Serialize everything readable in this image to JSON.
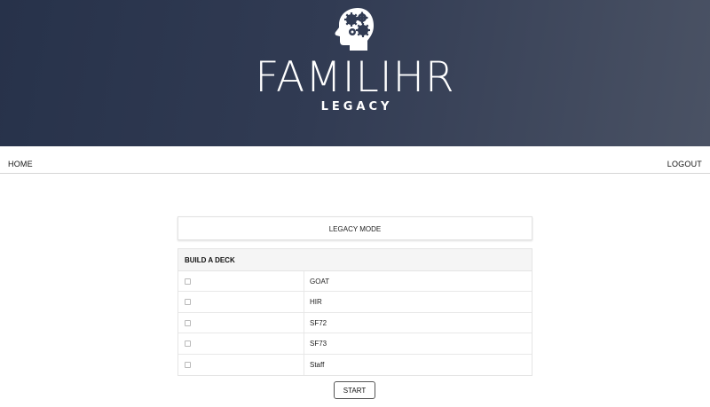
{
  "brand": {
    "title": "FAMILIHR",
    "subtitle": "LEGACY",
    "logo_icon": "brain-gears-icon"
  },
  "nav": {
    "home": "HOME",
    "logout": "LOGOUT"
  },
  "mode": {
    "label": "LEGACY MODE"
  },
  "deck": {
    "heading": "BUILD A DECK",
    "options": [
      {
        "label": "GOAT",
        "checked": false
      },
      {
        "label": "HIR",
        "checked": false
      },
      {
        "label": "SF72",
        "checked": false
      },
      {
        "label": "SF73",
        "checked": false
      },
      {
        "label": "Staff",
        "checked": false
      }
    ]
  },
  "actions": {
    "start": "START"
  },
  "colors": {
    "header_dark": "#27324a",
    "header_light": "#4a5264",
    "text": "#222222"
  }
}
